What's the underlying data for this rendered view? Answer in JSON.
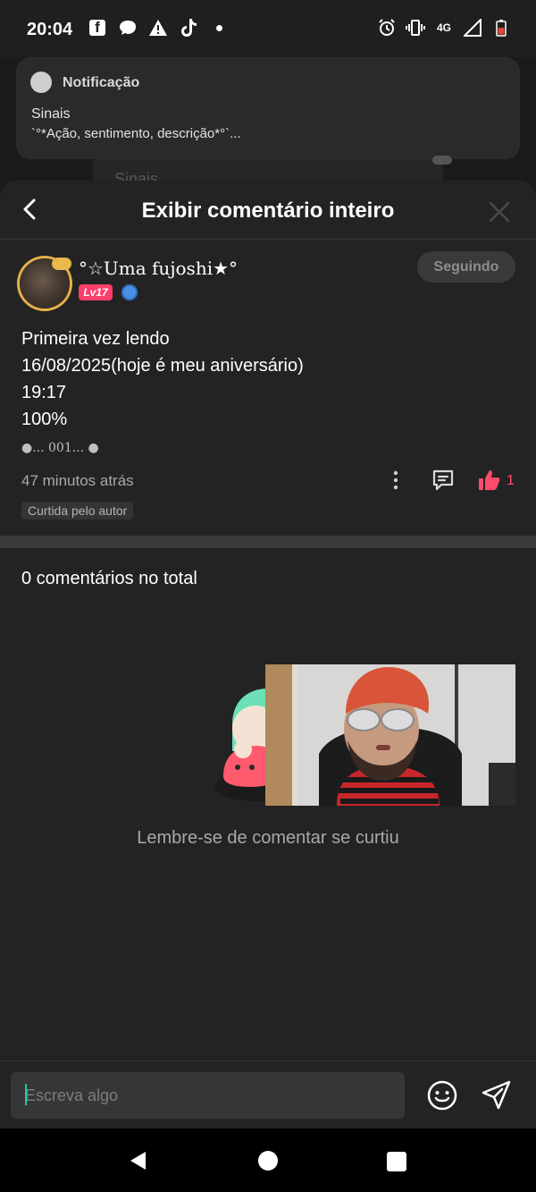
{
  "status_bar": {
    "time": "20:04",
    "left_icons": [
      "facebook-icon",
      "chat-bubble-icon",
      "warning-icon",
      "tiktok-icon",
      "dot-icon"
    ],
    "network_label": "4G",
    "right_icons": [
      "alarm-icon",
      "vibrate-icon",
      "signal-icon",
      "battery-icon"
    ]
  },
  "notification": {
    "app_name": "Notificação",
    "title": "Sinais",
    "body": "`°*Ação, sentimento, descrição*°`..."
  },
  "background_text": "Sinais",
  "header": {
    "title": "Exibir comentário inteiro"
  },
  "comment": {
    "username": "°☆Uma fujoshi★°",
    "level": "Lv17",
    "follow_label": "Seguindo",
    "lines": [
      "Primeira vez lendo",
      "16/08/2025(hoje é meu aniversário)",
      "19:17",
      "100%"
    ],
    "signature": "●... 001... ●",
    "time_ago": "47 minutos atrás",
    "like_count": "1",
    "author_liked": "Curtida pelo autor"
  },
  "replies": {
    "total_label": "0 comentários no total",
    "empty_hint": "Lembre-se de comentar se curtiu"
  },
  "composer": {
    "placeholder": "Escreva algo"
  },
  "colors": {
    "accent_like": "#ff4a6b",
    "level_badge": "#ff3d6a",
    "caret": "#1ec9a9",
    "background": "#232323"
  }
}
